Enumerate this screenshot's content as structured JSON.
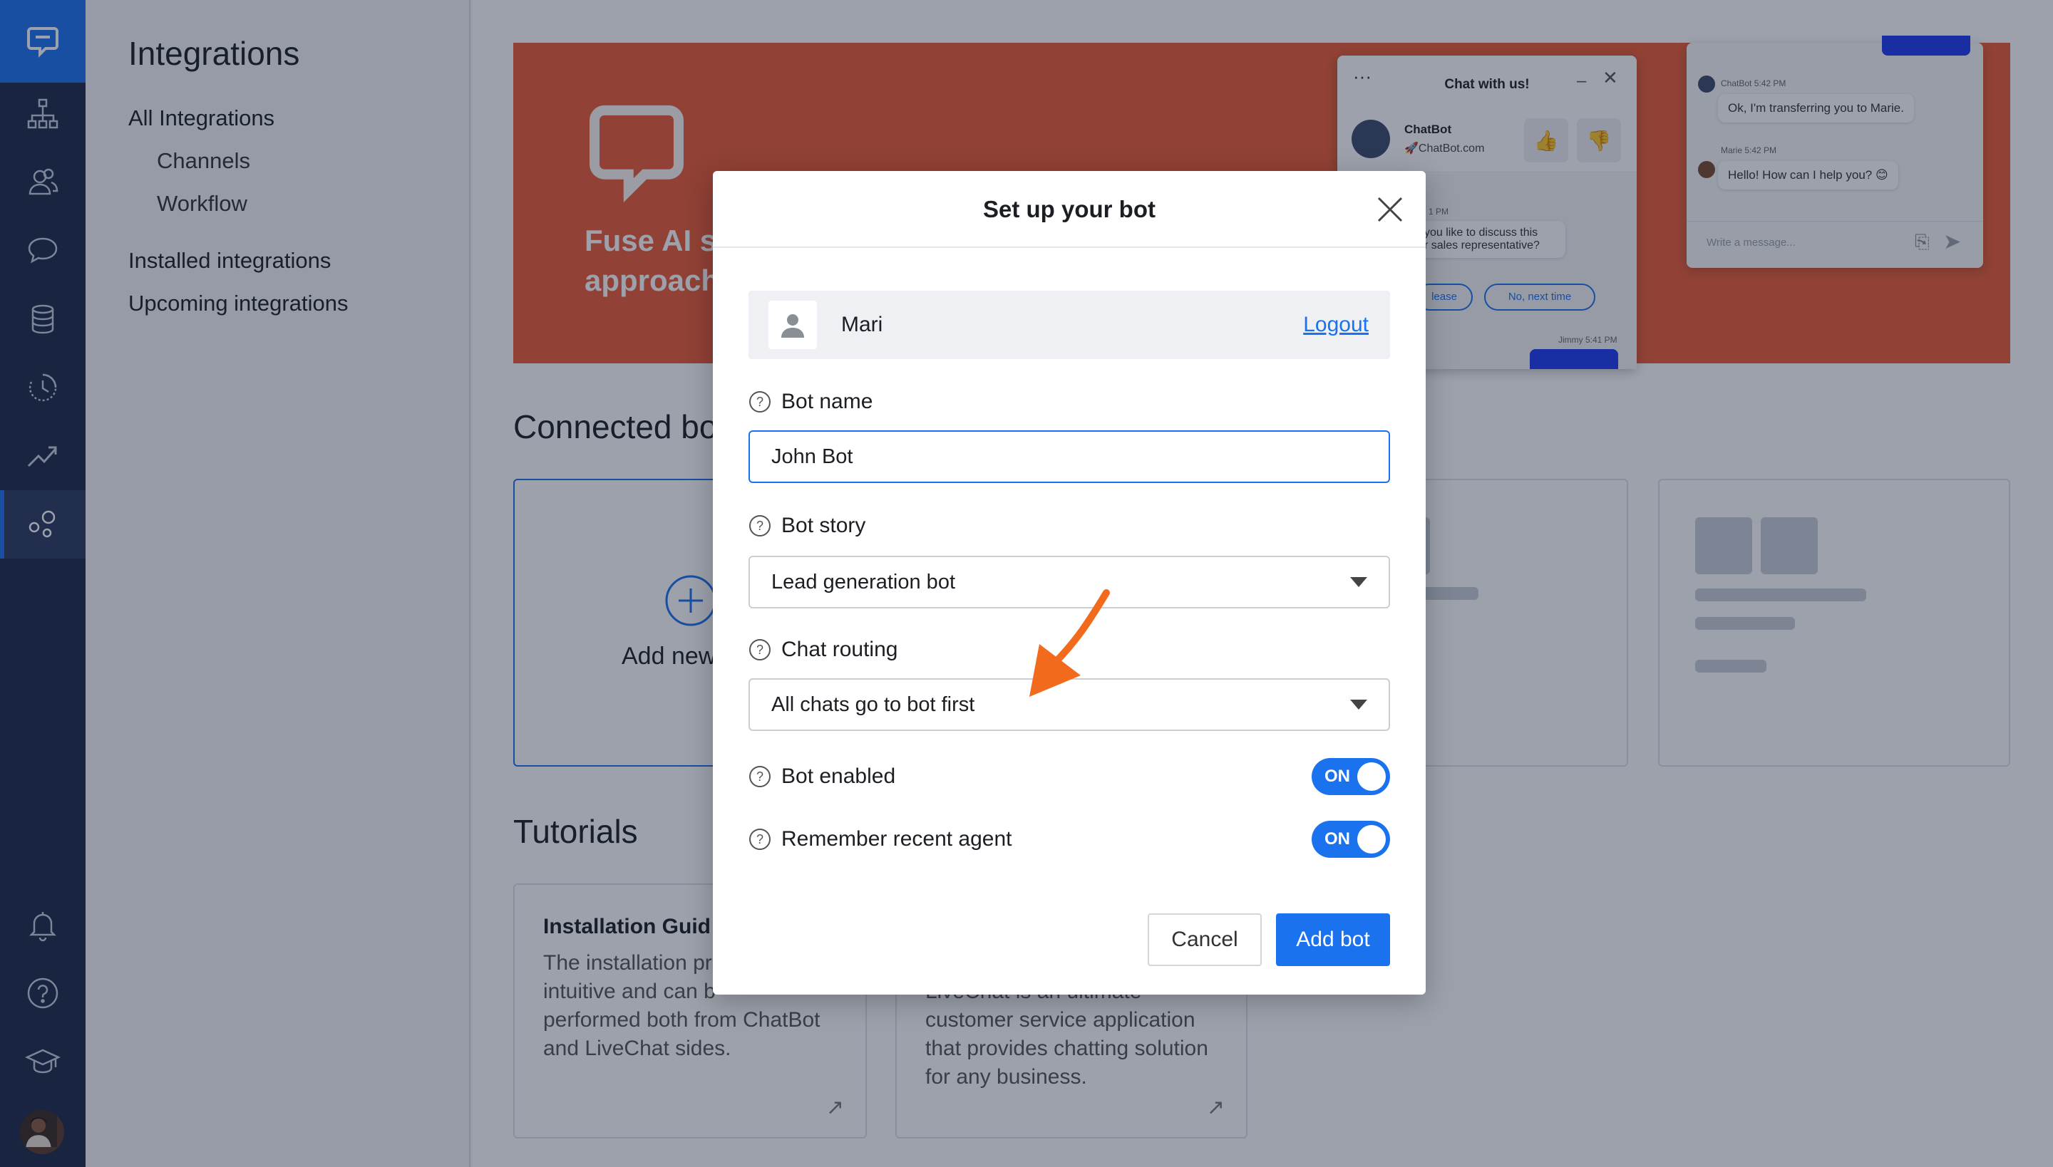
{
  "sidebar": {
    "title": "Integrations",
    "items": [
      {
        "label": "All Integrations"
      },
      {
        "label": "Channels"
      },
      {
        "label": "Workflow"
      },
      {
        "label": "Installed integrations"
      },
      {
        "label": "Upcoming integrations"
      }
    ]
  },
  "rail": {
    "icons": [
      "chat-logo-icon",
      "sitemap-icon",
      "users-icon",
      "chat-bubble-icon",
      "database-icon",
      "history-icon",
      "trending-up-icon",
      "integrations-icon",
      "bell-icon",
      "help-icon",
      "graduation-cap-icon",
      "user-avatar"
    ]
  },
  "banner": {
    "text_line1": "Fuse AI sc",
    "text_line2": "approach",
    "widget_title": "Chat with us!",
    "bot_name": "ChatBot",
    "bot_site": "🚀ChatBot.com",
    "msg_partial1": "you like to discuss this",
    "msg_partial2": "r sales representative?",
    "time_partial": "1 PM",
    "chip_please": "lease",
    "chip_next": "No, next time",
    "jimmy_time": "Jimmy 5:41 PM",
    "chatbot_time": "ChatBot 5:42 PM",
    "transfer_msg": "Ok, I'm transferring you to Marie.",
    "marie_time": "Marie 5:42 PM",
    "marie_msg": "Hello! How can I help you? 😊",
    "write_placeholder": "Write a message..."
  },
  "main": {
    "connected_title": "Connected bo",
    "add_new_label": "Add new",
    "tutorials_title": "Tutorials",
    "tutorial1_title": "Installation Guid",
    "tutorial1_body": [
      "The installation pr",
      "intuitive and can b",
      "performed both from ChatBot",
      "and LiveChat sides."
    ],
    "tutorial2_body": [
      "LiveChat is an ultimate",
      "customer service application",
      "that provides chatting solution",
      "for any business."
    ]
  },
  "modal": {
    "title": "Set up your bot",
    "user_name": "Mari",
    "logout_label": "Logout",
    "bot_name_label": "Bot name",
    "bot_name_value": "John Bot",
    "bot_story_label": "Bot story",
    "bot_story_value": "Lead generation bot",
    "chat_routing_label": "Chat routing",
    "chat_routing_value": "All chats go to bot first",
    "bot_enabled_label": "Bot enabled",
    "bot_enabled_state": "ON",
    "remember_agent_label": "Remember recent agent",
    "remember_agent_state": "ON",
    "cancel_label": "Cancel",
    "add_label": "Add bot"
  },
  "colors": {
    "accent": "#1a72ef",
    "rail": "#1b2947",
    "banner": "#ea5b34",
    "arrow": "#f26a1b"
  }
}
